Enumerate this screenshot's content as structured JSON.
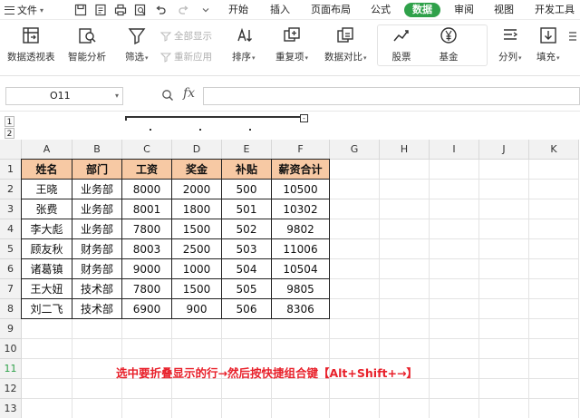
{
  "menubar": {
    "file_label": "文件",
    "tabs": [
      "开始",
      "插入",
      "页面布局",
      "公式",
      "数据",
      "审阅",
      "视图",
      "开发工具"
    ],
    "active_tab": "数据"
  },
  "ribbon": {
    "pivot_label": "数据透视表",
    "smart_analysis_label": "智能分析",
    "filter_label": "筛选",
    "show_all_label": "全部显示",
    "reapply_label": "重新应用",
    "sort_label": "排序",
    "duplicates_label": "重复项",
    "compare_label": "数据对比",
    "stock_label": "股票",
    "fund_label": "基金",
    "split_label": "分列",
    "fill_label": "填充"
  },
  "formula_bar": {
    "name_box": "O11",
    "fx_label": "fx",
    "formula": ""
  },
  "outline": {
    "levels": [
      "1",
      "2"
    ],
    "minus": "-"
  },
  "sheet": {
    "columns": [
      "A",
      "B",
      "C",
      "D",
      "E",
      "F",
      "G",
      "H",
      "I",
      "J",
      "K"
    ],
    "rows": [
      "1",
      "2",
      "3",
      "4",
      "5",
      "6",
      "7",
      "8",
      "9",
      "10",
      "11",
      "12",
      "13"
    ],
    "table": {
      "headers": [
        "姓名",
        "部门",
        "工资",
        "奖金",
        "补贴",
        "薪资合计"
      ],
      "data": [
        [
          "王晓",
          "业务部",
          "8000",
          "2000",
          "500",
          "10500"
        ],
        [
          "张费",
          "业务部",
          "8001",
          "1800",
          "501",
          "10302"
        ],
        [
          "李大彪",
          "业务部",
          "7800",
          "1500",
          "502",
          "9802"
        ],
        [
          "顾友秋",
          "财务部",
          "8003",
          "2500",
          "503",
          "11006"
        ],
        [
          "诸葛镇",
          "财务部",
          "9000",
          "1000",
          "504",
          "10504"
        ],
        [
          "王大妞",
          "技术部",
          "7800",
          "1500",
          "505",
          "9805"
        ],
        [
          "刘二飞",
          "技术部",
          "6900",
          "900",
          "506",
          "8306"
        ]
      ]
    },
    "note": "选中要折叠显示的行→然后按快捷组合键【Alt+Shift+→】"
  },
  "colors": {
    "accent": "#2fa14a",
    "header_fill": "#f7c9a4",
    "note": "#e8202a"
  }
}
